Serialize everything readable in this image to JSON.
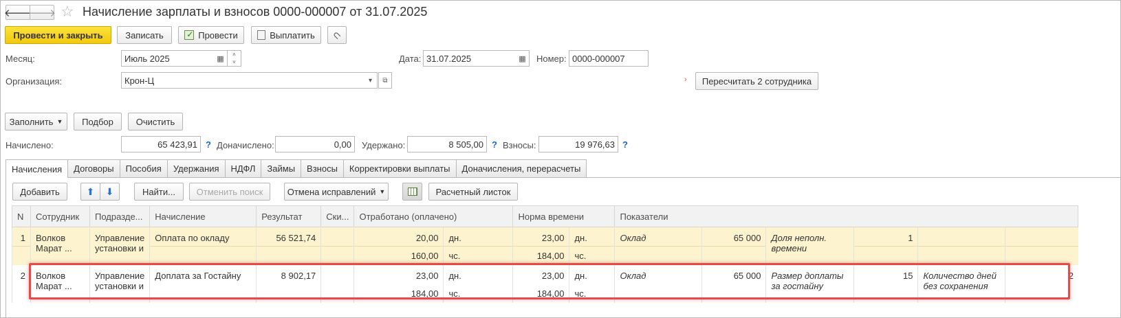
{
  "window": {
    "title": "Начисление зарплаты и взносов 0000-000007 от 31.07.2025"
  },
  "toolbar": {
    "post_close": "Провести и закрыть",
    "save": "Записать",
    "post": "Провести",
    "pay": "Выплатить"
  },
  "form": {
    "month_label": "Месяц:",
    "month_value": "Июль 2025",
    "date_label": "Дата:",
    "date_value": "31.07.2025",
    "number_label": "Номер:",
    "number_value": "0000-000007",
    "org_label": "Организация:",
    "org_value": "Крон-Ц",
    "recalc_button": "Пересчитать 2 сотрудника",
    "fill_button": "Заполнить",
    "select_button": "Подбор",
    "clear_button": "Очистить"
  },
  "totals": {
    "accrued_label": "Начислено:",
    "accrued_value": "65 423,91",
    "extra_label": "Доначислено:",
    "extra_value": "0,00",
    "withheld_label": "Удержано:",
    "withheld_value": "8 505,00",
    "contrib_label": "Взносы:",
    "contrib_value": "19 976,63",
    "help": "?"
  },
  "tabs": [
    "Начисления",
    "Договоры",
    "Пособия",
    "Удержания",
    "НДФЛ",
    "Займы",
    "Взносы",
    "Корректировки выплаты",
    "Доначисления, перерасчеты"
  ],
  "table_toolbar": {
    "add": "Добавить",
    "find": "Найти...",
    "cancel_search": "Отменить поиск",
    "cancel_fixes": "Отмена исправлений",
    "payslip": "Расчетный листок"
  },
  "table": {
    "headers": [
      "N",
      "Сотрудник",
      "Подразде...",
      "Начисление",
      "Результат",
      "Ски...",
      "Отработано (оплачено)",
      "Норма времени",
      "Показатели"
    ],
    "rows": [
      {
        "n": "1",
        "employee": "Волков Марат ...",
        "dept": "Управление установки и",
        "accrual": "Оплата по окладу",
        "result": "56 521,74",
        "worked_days": "20,00",
        "worked_days_unit": "дн.",
        "worked_hours": "160,00",
        "worked_hours_unit": "чс.",
        "norm_days": "23,00",
        "norm_days_unit": "дн.",
        "norm_hours": "184,00",
        "norm_hours_unit": "чс.",
        "ind1_name": "Оклад",
        "ind1_value": "65 000",
        "ind2_name": "Доля неполн. времени",
        "ind2_value": "1",
        "ind3_name": "",
        "ind3_value": ""
      },
      {
        "n": "2",
        "employee": "Волков Марат ...",
        "dept": "Управление установки и",
        "accrual": "Доплата за Гостайну",
        "result": "8 902,17",
        "worked_days": "23,00",
        "worked_days_unit": "дн.",
        "worked_hours": "184,00",
        "worked_hours_unit": "чс.",
        "norm_days": "23,00",
        "norm_days_unit": "дн.",
        "norm_hours": "184,00",
        "norm_hours_unit": "чс.",
        "ind1_name": "Оклад",
        "ind1_value": "65 000",
        "ind2_name": "Размер доплаты за гостайну",
        "ind2_value": "15",
        "ind3_name": "Количество дней без сохранения",
        "ind3_value": "2"
      }
    ]
  },
  "colors": {
    "primary_button": "#f4d21f",
    "selected_row": "#fdf4cf",
    "highlight_border": "#e84a48",
    "help_link": "#1a64c6"
  }
}
